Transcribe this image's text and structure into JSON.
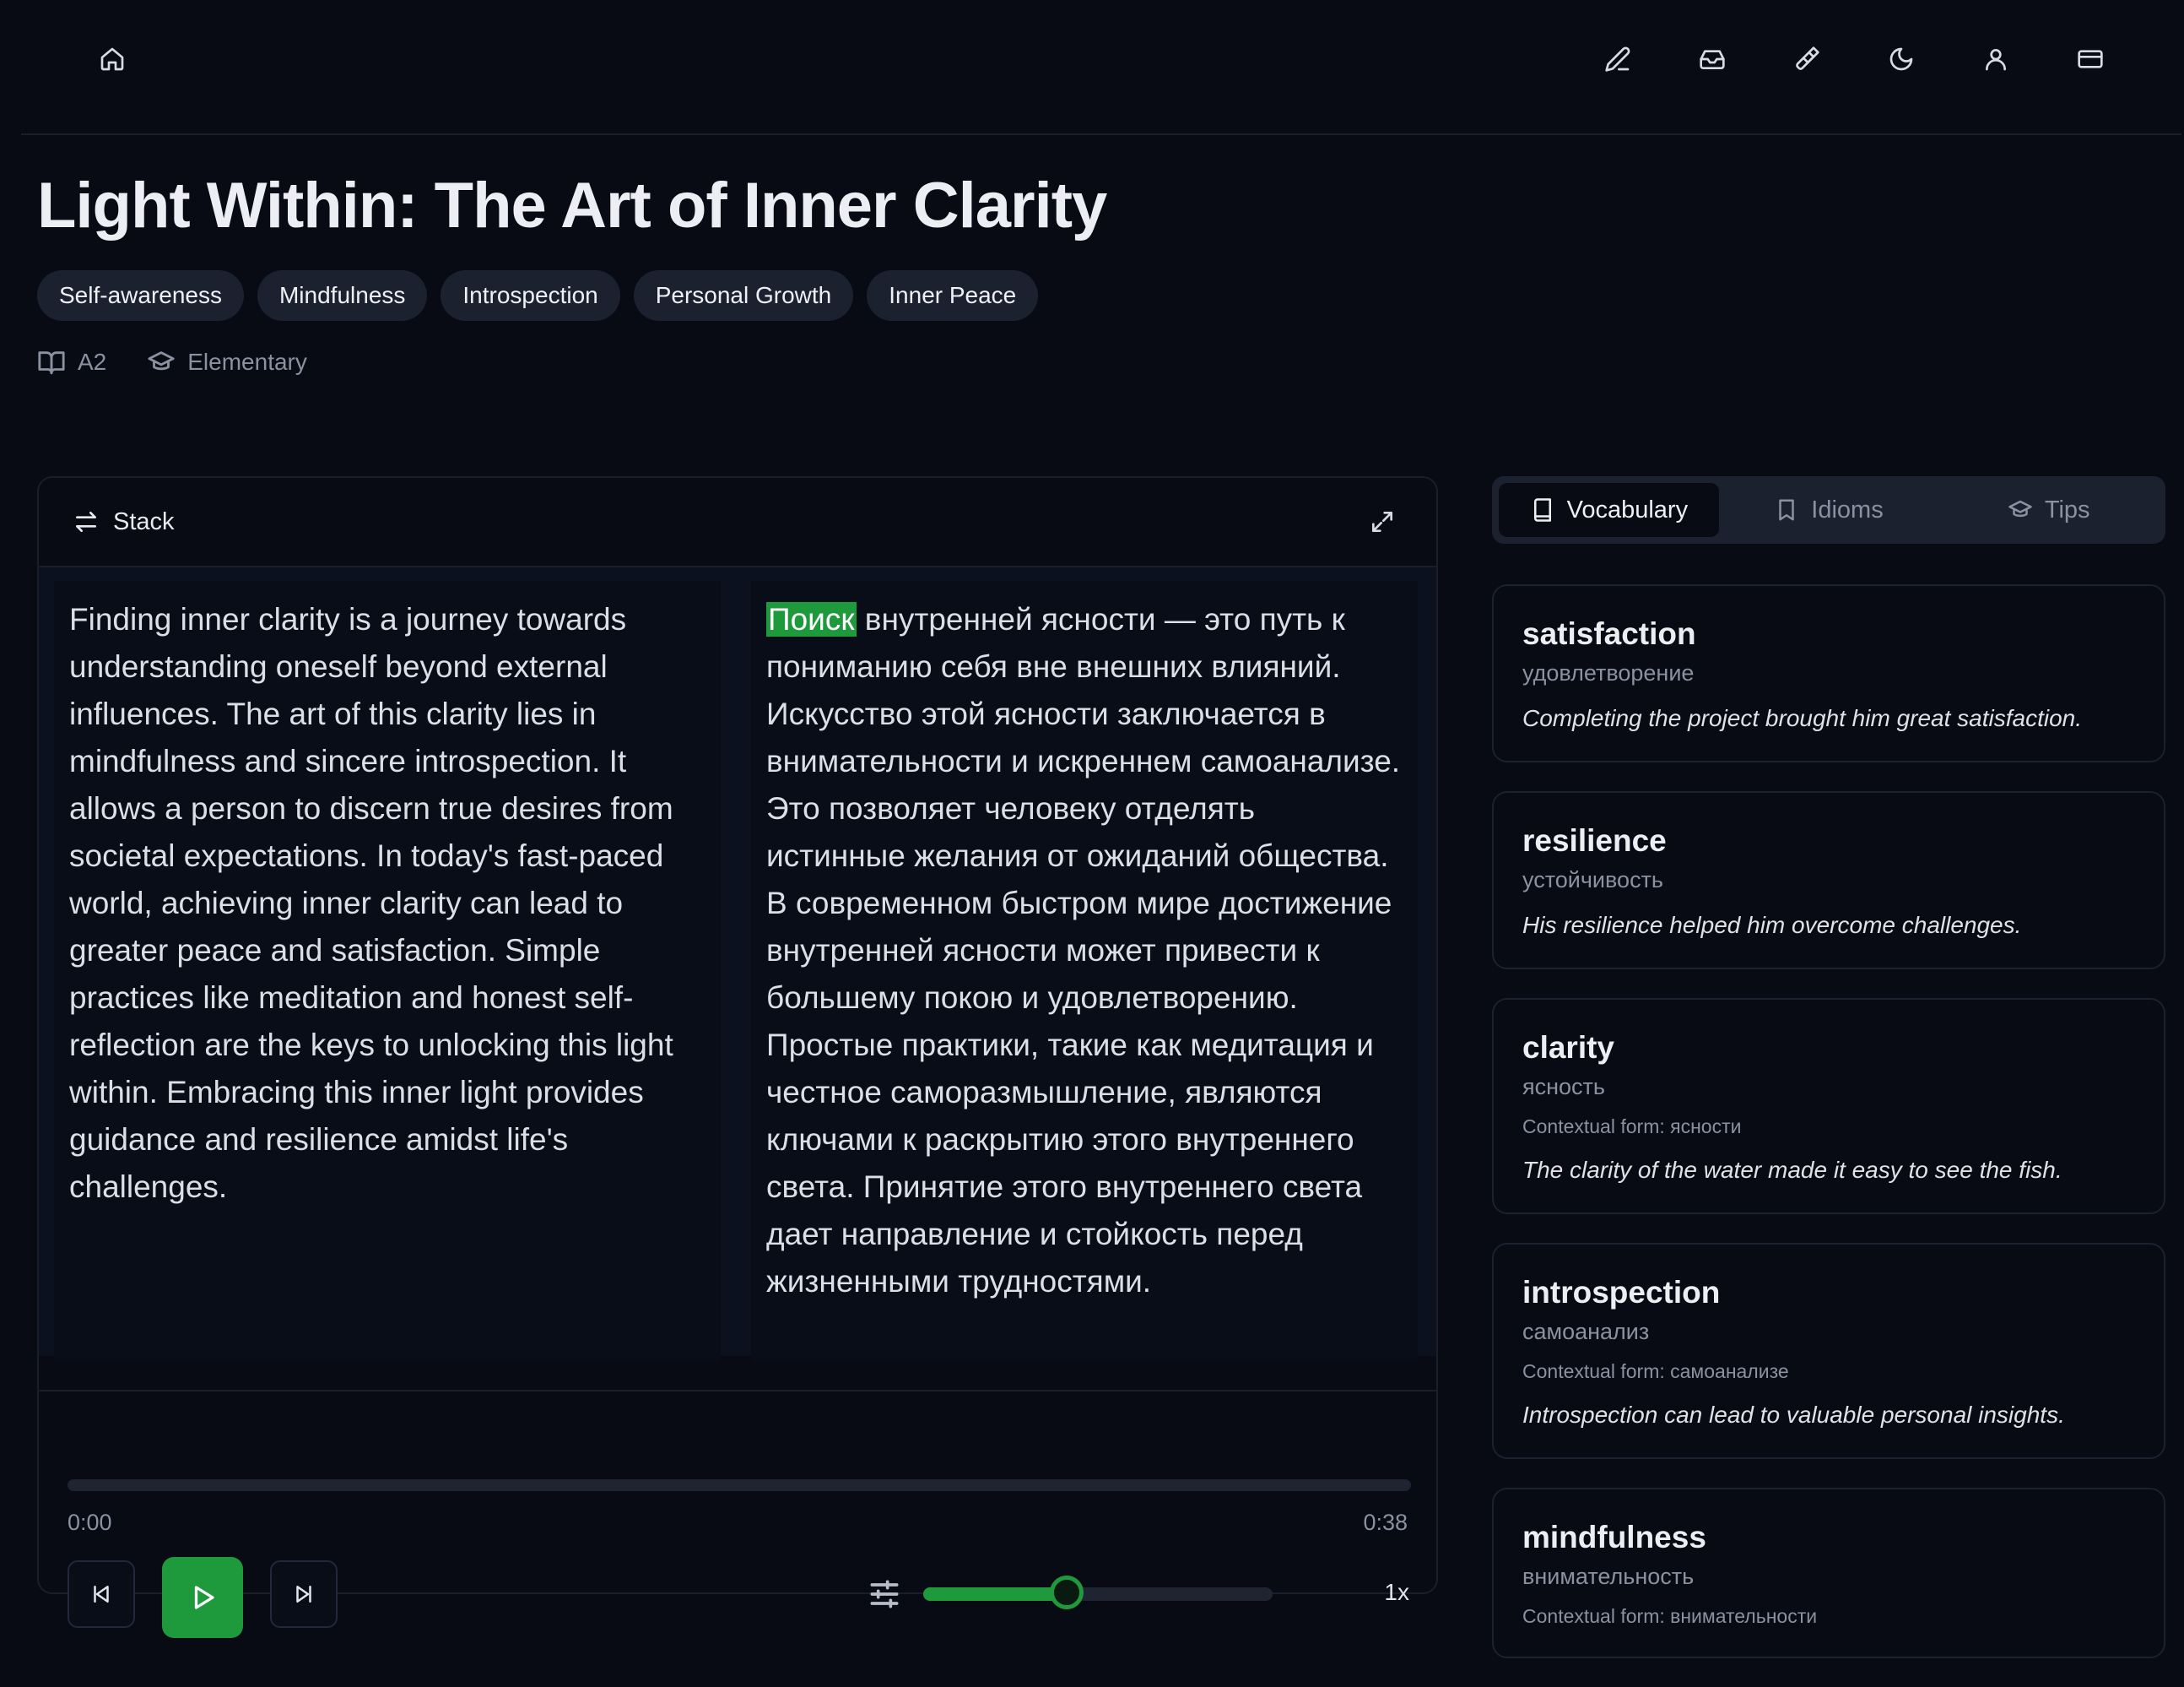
{
  "header": {
    "icons": [
      "home-icon",
      "pencil-icon",
      "inbox-icon",
      "paintbrush-icon",
      "moon-icon",
      "user-icon",
      "credit-card-icon"
    ]
  },
  "article": {
    "title": "Light Within: The Art of Inner Clarity",
    "tags": [
      "Self-awareness",
      "Mindfulness",
      "Introspection",
      "Personal Growth",
      "Inner Peace"
    ],
    "level": "A2",
    "level_name": "Elementary"
  },
  "reader": {
    "layout_label": "Stack",
    "english_text": "Finding inner clarity is a journey towards understanding oneself beyond external influences. The art of this clarity lies in mindfulness and sincere introspection. It allows a person to discern true desires from societal expectations. In today's fast-paced world, achieving inner clarity can lead to greater peace and satisfaction. Simple practices like meditation and honest self-reflection are the keys to unlocking this light within. Embracing this inner light provides guidance and resilience amidst life's challenges.",
    "translation_highlight": "Поиск",
    "translation_rest": " внутренней ясности — это путь к пониманию себя вне внешних влияний. Искусство этой ясности заключается в внимательности и искреннем самоанализе. Это позволяет человеку отделять истинные желания от ожиданий общества. В современном быстром мире достижение внутренней ясности может привести к большему покою и удовлетворению. Простые практики, такие как медитация и честное саморазмышление, являются ключами к раскрытию этого внутреннего света. Принятие этого внутреннего света дает направление и стойкость перед жизненными трудностями."
  },
  "player": {
    "current_time": "0:00",
    "duration": "0:38",
    "progress": 0.0,
    "speed_label": "1x",
    "speed_slider_fraction": 0.41,
    "accent_color": "#1e9a3c"
  },
  "sidebar": {
    "tabs": [
      {
        "label": "Vocabulary",
        "icon": "book-icon",
        "active": true
      },
      {
        "label": "Idioms",
        "icon": "bookmark-icon",
        "active": false
      },
      {
        "label": "Tips",
        "icon": "graduation-cap-icon",
        "active": false
      }
    ],
    "vocabulary": [
      {
        "word": "satisfaction",
        "translation": "удовлетворение",
        "context": "",
        "example": "Completing the project brought him great satisfaction."
      },
      {
        "word": "resilience",
        "translation": "устойчивость",
        "context": "",
        "example": "His resilience helped him overcome challenges."
      },
      {
        "word": "clarity",
        "translation": "ясность",
        "context": "Contextual form: ясности",
        "example": "The clarity of the water made it easy to see the fish."
      },
      {
        "word": "introspection",
        "translation": "самоанализ",
        "context": "Contextual form: самоанализе",
        "example": "Introspection can lead to valuable personal insights."
      },
      {
        "word": "mindfulness",
        "translation": "внимательность",
        "context": "Contextual form: внимательности",
        "example": ""
      }
    ]
  }
}
